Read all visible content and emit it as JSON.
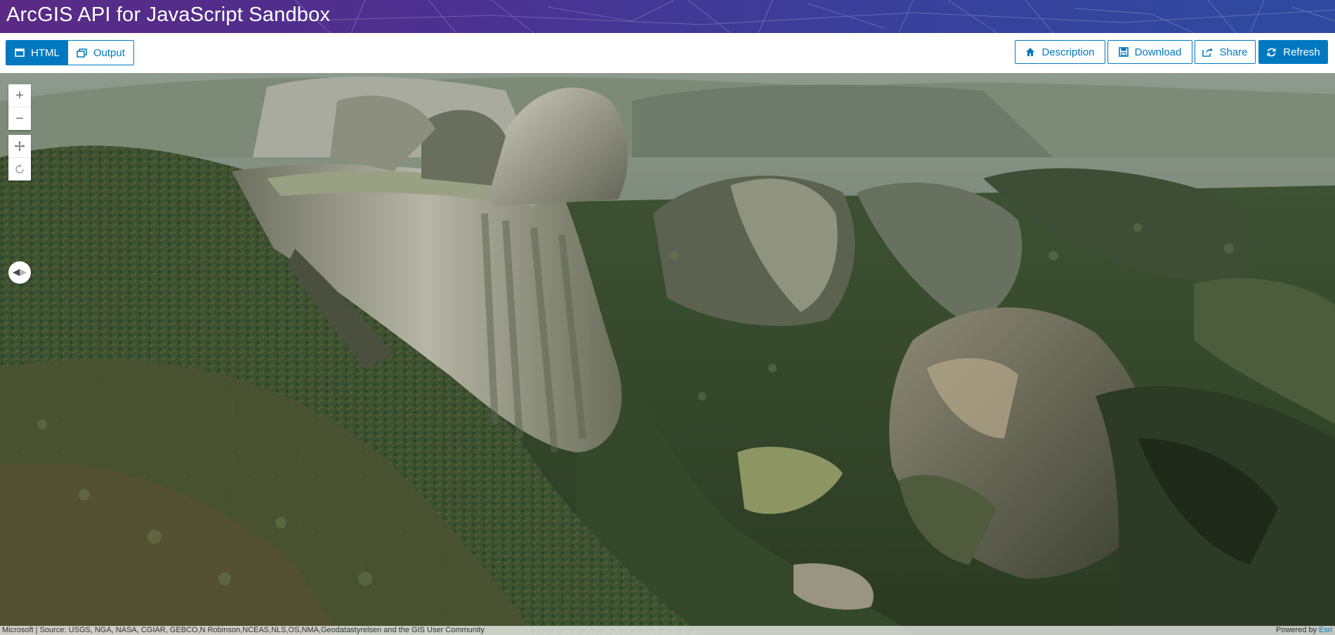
{
  "header": {
    "title": "ArcGIS API for JavaScript Sandbox"
  },
  "toolbar": {
    "view_toggle": {
      "html_label": "HTML",
      "output_label": "Output",
      "active": "HTML"
    },
    "description_label": "Description",
    "download_label": "Download",
    "share_label": "Share",
    "refresh_label": "Refresh"
  },
  "map": {
    "navigation": {
      "zoom_in": "+",
      "zoom_out": "−",
      "pan": "pan-icon",
      "rotate": "rotate-icon",
      "compass": "compass-icon"
    },
    "attribution": {
      "source_text": "Microsoft | Source: USGS, NGA, NASA, CGIAR, GEBCO,N Robinson,NCEAS,NLS,OS,NMA,Geodatastyrelsen and the GIS User Community",
      "powered_by": "Powered by",
      "esri": "Esri"
    }
  },
  "colors": {
    "accent": "#0079c1",
    "header_start": "#5a2a86",
    "header_end": "#2f4aa0"
  }
}
